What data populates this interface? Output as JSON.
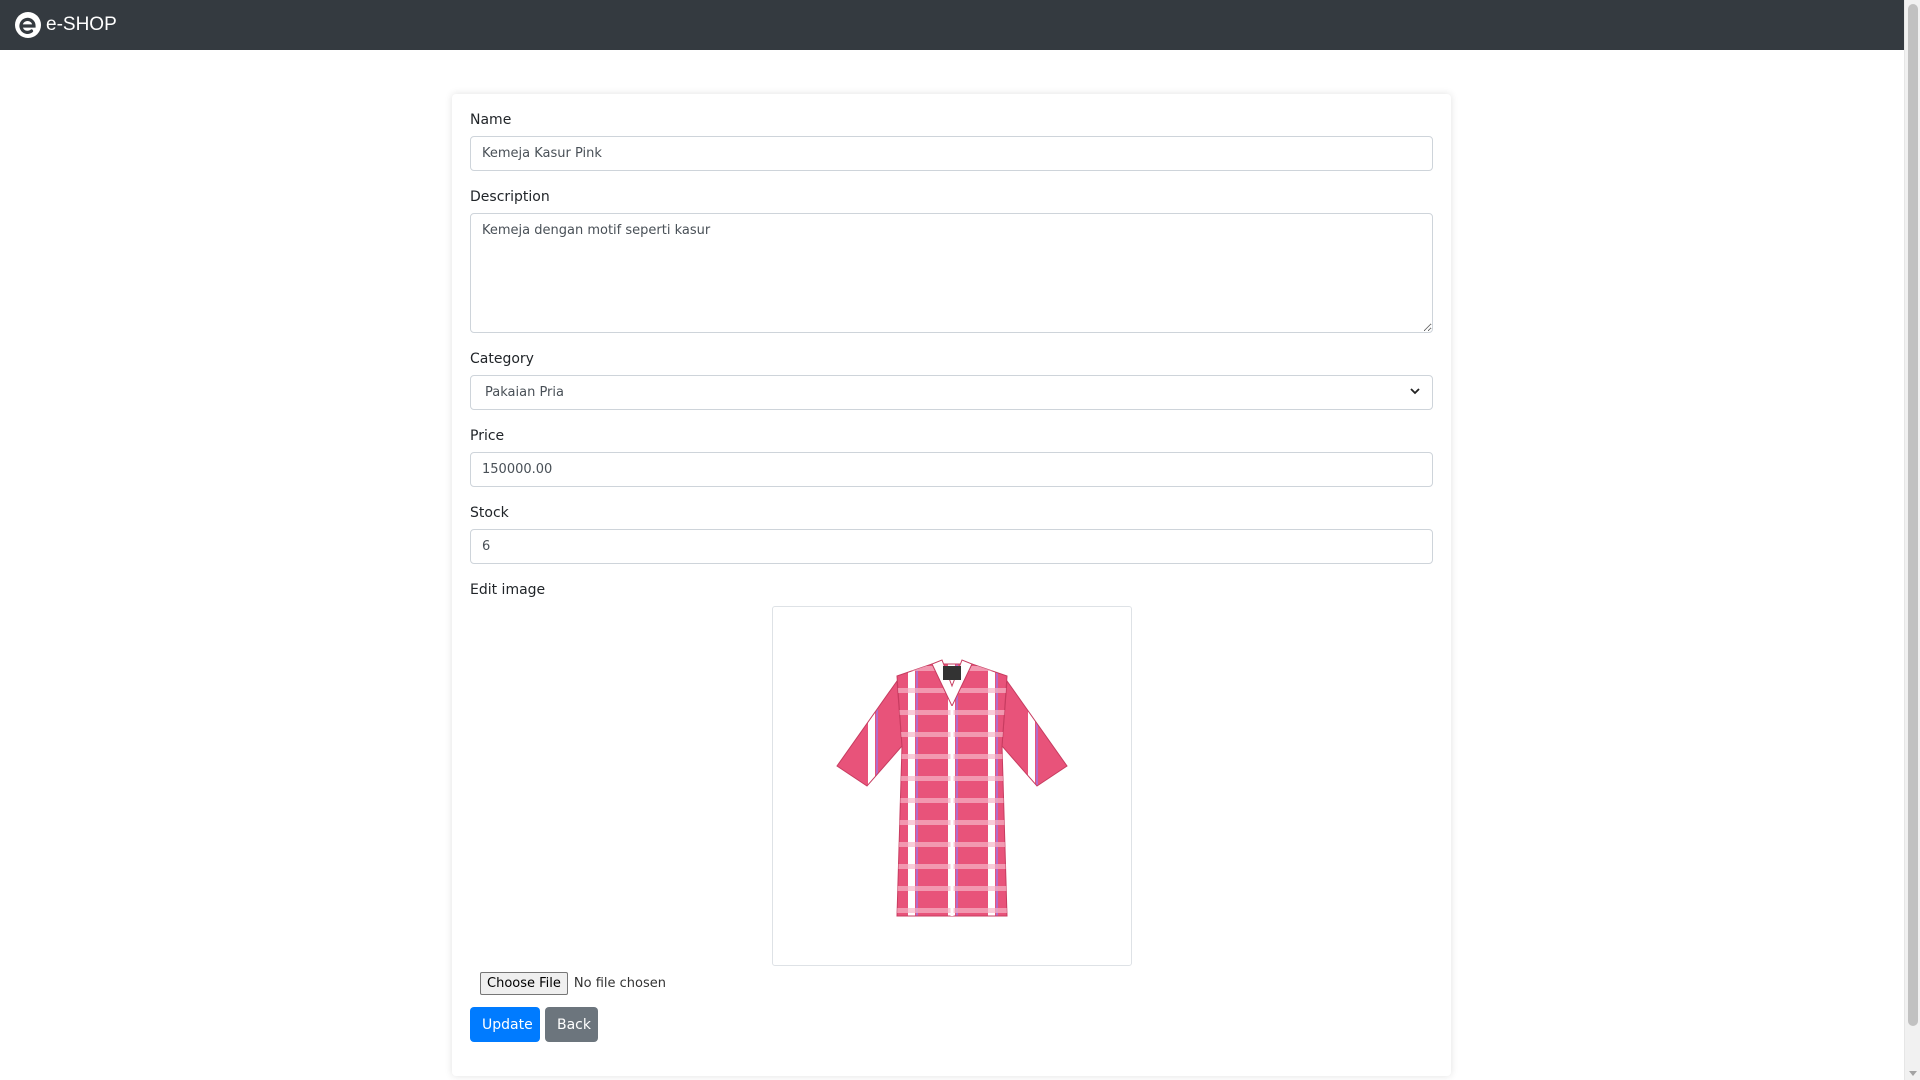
{
  "navbar": {
    "brand": "e-SHOP",
    "logo_icon": "e-shop-logo-icon"
  },
  "form": {
    "name": {
      "label": "Name",
      "value": "Kemeja Kasur Pink"
    },
    "description": {
      "label": "Description",
      "value": "Kemeja dengan motif seperti kasur"
    },
    "category": {
      "label": "Category",
      "selected": "Pakaian Pria"
    },
    "price": {
      "label": "Price",
      "value": "150000.00"
    },
    "stock": {
      "label": "Stock",
      "value": "6"
    },
    "image": {
      "label": "Edit image",
      "choose_file_label": "Choose File",
      "file_status": "No file chosen"
    },
    "buttons": {
      "update": "Update",
      "back": "Back"
    }
  },
  "colors": {
    "navbar": "#343a40",
    "primary": "#007bff",
    "secondary": "#6c757d",
    "shirt_pink": "#e8537a"
  }
}
